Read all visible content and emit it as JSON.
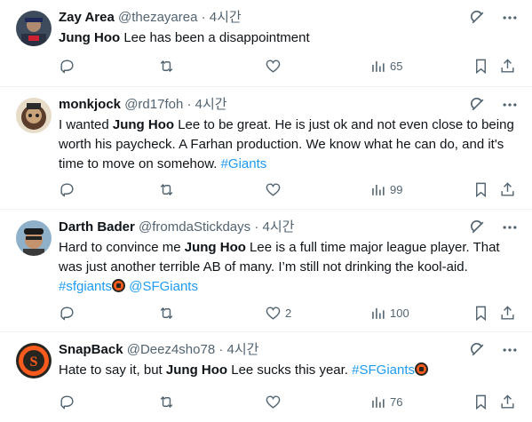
{
  "tweets": [
    {
      "name": "Zay Area",
      "handle": "@thezayarea",
      "sep": "·",
      "time": "4시간",
      "parts": [
        {
          "t": "b",
          "v": "Jung Hoo"
        },
        {
          "t": "p",
          "v": " Lee has been a disappointment"
        }
      ],
      "views": "65",
      "replies": "",
      "retweets": "",
      "likes": ""
    },
    {
      "name": "monkjock",
      "handle": "@rd17foh",
      "sep": "·",
      "time": "4시간",
      "parts": [
        {
          "t": "p",
          "v": "I wanted "
        },
        {
          "t": "b",
          "v": "Jung Hoo"
        },
        {
          "t": "p",
          "v": " Lee to be great. He is just ok and not even close to being worth his paycheck. A Farhan production.  We know what he can do, and it's time to move on somehow.  "
        },
        {
          "t": "l",
          "v": "#Giants"
        }
      ],
      "views": "99",
      "replies": "",
      "retweets": "",
      "likes": ""
    },
    {
      "name": "Darth Bader",
      "handle": "@fromdaStickdays",
      "sep": "·",
      "time": "4시간",
      "parts": [
        {
          "t": "p",
          "v": "Hard to convince me "
        },
        {
          "t": "b",
          "v": "Jung Hoo"
        },
        {
          "t": "p",
          "v": " Lee is a full time major league player. That was just another terrible AB of many. I’m still not drinking the kool-aid. "
        },
        {
          "t": "l",
          "v": "#sfgiants"
        },
        {
          "t": "e",
          "v": ""
        },
        {
          "t": "p",
          "v": " "
        },
        {
          "t": "l",
          "v": "@SFGiants"
        }
      ],
      "views": "100",
      "replies": "",
      "retweets": "",
      "likes": "2"
    },
    {
      "name": "SnapBack",
      "handle": "@Deez4sho78",
      "sep": "·",
      "time": "4시간",
      "parts": [
        {
          "t": "p",
          "v": "Hate to say it, but "
        },
        {
          "t": "b",
          "v": "Jung Hoo"
        },
        {
          "t": "p",
          "v": " Lee sucks this year. "
        },
        {
          "t": "l",
          "v": "#SFGiants"
        },
        {
          "t": "e",
          "v": ""
        }
      ],
      "views": "76",
      "replies": "",
      "retweets": "",
      "likes": ""
    }
  ],
  "icons": {
    "grok": "grok-icon",
    "more": "more-icon",
    "reply": "reply-icon",
    "retweet": "retweet-icon",
    "like": "like-icon",
    "views": "views-icon",
    "bookmark": "bookmark-icon",
    "share": "share-icon",
    "sf_emoji": "sf-giants-emoji"
  },
  "colors": {
    "text": "#0f1419",
    "secondary": "#536471",
    "link": "#1d9bf0",
    "divider": "#eff3f4"
  }
}
